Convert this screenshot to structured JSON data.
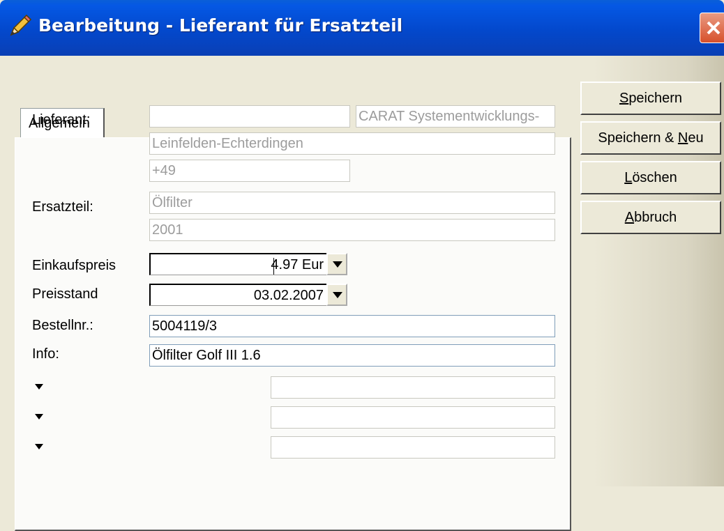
{
  "window": {
    "title": "Bearbeitung - Lieferant für Ersatzteil",
    "icon": "pencil-icon",
    "close_icon": "close-icon"
  },
  "tabs": [
    {
      "label": "Allgemein",
      "active": true
    }
  ],
  "form": {
    "lieferant_label": "Lieferant:",
    "lieferant_nr": "",
    "lieferant_name": "CARAT Systementwicklungs-",
    "lieferant_ort": "Leinfelden-Echterdingen",
    "lieferant_tel": "+49",
    "ersatzteil_label": "Ersatzteil:",
    "ersatzteil_name": "Ölfilter",
    "ersatzteil_nr": "2001",
    "einkaufspreis_label": "Einkaufspreis",
    "einkaufspreis_value": "4.97 Eur",
    "preisstand_label": "Preisstand",
    "preisstand_value": "03.02.2007",
    "bestellnr_label": "Bestellnr.:",
    "bestellnr_value": "5004119/3",
    "info_label": "Info:",
    "info_value": "Ölfilter Golf III 1.6",
    "extra_fields": [
      "",
      "",
      ""
    ],
    "bullet_icon": "arrow-bullet-icon"
  },
  "buttons": {
    "speichern": {
      "pre": "",
      "key": "S",
      "post": "peichern"
    },
    "speichern_neu": {
      "pre": "Speichern & ",
      "key": "N",
      "post": "eu"
    },
    "loeschen": {
      "pre": "",
      "key": "L",
      "post": "öschen"
    },
    "abbruch": {
      "pre": "",
      "key": "A",
      "post": "bbruch"
    }
  }
}
